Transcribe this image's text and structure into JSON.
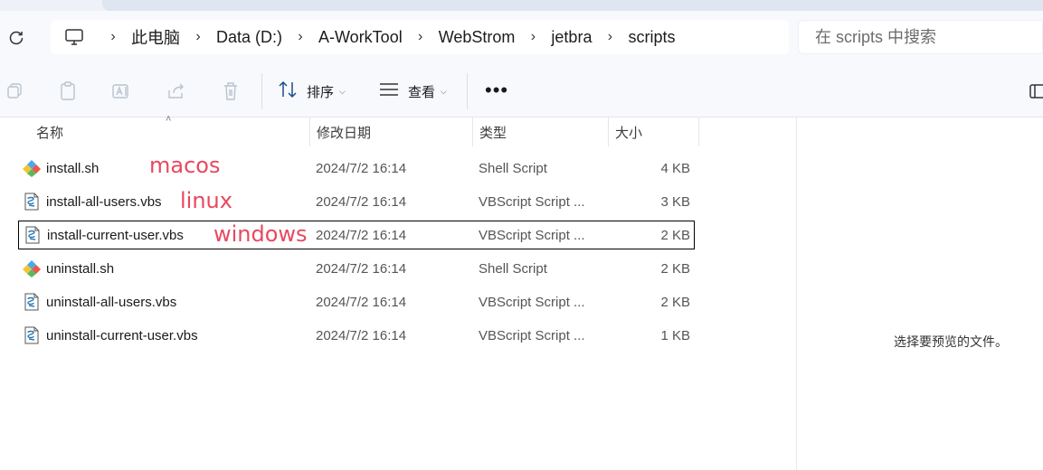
{
  "breadcrumb": {
    "root_icon": "computer-icon",
    "items": [
      "此电脑",
      "Data (D:)",
      "A-WorkTool",
      "WebStrom",
      "jetbra",
      "scripts"
    ]
  },
  "search": {
    "placeholder": "在 scripts 中搜索"
  },
  "toolbar": {
    "sort_label": "排序",
    "view_label": "查看",
    "more_label": "•••"
  },
  "columns": {
    "name": "名称",
    "date": "修改日期",
    "type": "类型",
    "size": "大小"
  },
  "files": [
    {
      "name": "install.sh",
      "date": "2024/7/2 16:14",
      "type": "Shell Script",
      "size": "4 KB",
      "icon": "shell-script-icon"
    },
    {
      "name": "install-all-users.vbs",
      "date": "2024/7/2 16:14",
      "type": "VBScript Script ...",
      "size": "3 KB",
      "icon": "vbscript-icon"
    },
    {
      "name": "install-current-user.vbs",
      "date": "2024/7/2 16:14",
      "type": "VBScript Script ...",
      "size": "2 KB",
      "icon": "vbscript-icon"
    },
    {
      "name": "uninstall.sh",
      "date": "2024/7/2 16:14",
      "type": "Shell Script",
      "size": "2 KB",
      "icon": "shell-script-icon"
    },
    {
      "name": "uninstall-all-users.vbs",
      "date": "2024/7/2 16:14",
      "type": "VBScript Script ...",
      "size": "2 KB",
      "icon": "vbscript-icon"
    },
    {
      "name": "uninstall-current-user.vbs",
      "date": "2024/7/2 16:14",
      "type": "VBScript Script ...",
      "size": "1 KB",
      "icon": "vbscript-icon"
    }
  ],
  "annotations": [
    "macos",
    "linux",
    "windows"
  ],
  "preview": {
    "message": "选择要预览的文件。"
  },
  "colors": {
    "annotation": "#e8485f",
    "accent": "#005fb8"
  }
}
